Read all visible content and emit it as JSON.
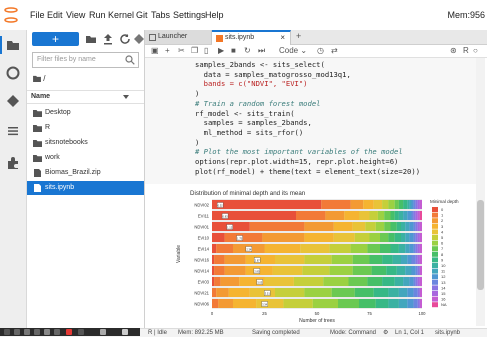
{
  "menu": {
    "items": [
      "File",
      "Edit",
      "View",
      "Run",
      "Kernel",
      "Git",
      "Tabs",
      "Settings",
      "Help"
    ],
    "memory": "Mem:956"
  },
  "filebrowser": {
    "new_label": "+",
    "filter_placeholder": "Filter files by name",
    "breadcrumb": "/",
    "column_name": "Name",
    "files": [
      {
        "name": "Desktop",
        "type": "folder",
        "selected": false
      },
      {
        "name": "R",
        "type": "folder",
        "selected": false
      },
      {
        "name": "sitsnotebooks",
        "type": "folder",
        "selected": false
      },
      {
        "name": "work",
        "type": "folder",
        "selected": false
      },
      {
        "name": "Biomas_Brazil.zip",
        "type": "file",
        "selected": false
      },
      {
        "name": "sits.ipynb",
        "type": "notebook",
        "selected": true
      }
    ]
  },
  "tabs": [
    {
      "label": "Launcher",
      "active": false
    },
    {
      "label": "sits.ipynb",
      "active": true
    }
  ],
  "notebook_toolbar": {
    "cell_type": "Code",
    "kernel_indicator": "R"
  },
  "code_lines": [
    {
      "t": "samples_2bands <- sits_select(",
      "c": ""
    },
    {
      "t": "  data = samples_matogrosso_mod13q1,",
      "c": ""
    },
    {
      "t": "  bands = c(\"NDVI\", \"EVI\")",
      "c": "str"
    },
    {
      "t": ")",
      "c": ""
    },
    {
      "t": "# Train a random forest model",
      "c": "cmt"
    },
    {
      "t": "rf_model <- sits_train(",
      "c": ""
    },
    {
      "t": "  samples = samples_2bands,",
      "c": ""
    },
    {
      "t": "  ml_method = sits_rfor()",
      "c": ""
    },
    {
      "t": ")",
      "c": ""
    },
    {
      "t": "# Plot the most important variables of the model",
      "c": "cmt"
    },
    {
      "t": "options(repr.plot.width=15, repr.plot.height=6)",
      "c": ""
    },
    {
      "t": "plot(rf_model) + theme(text = element_text(size=20))",
      "c": ""
    }
  ],
  "chart_data": {
    "type": "bar",
    "title": "Distribution of minimal depth and its mean",
    "xlabel": "Number of trees",
    "ylabel": "Variable",
    "xlim": [
      0,
      100
    ],
    "xticks": [
      0,
      25,
      50,
      75,
      100
    ],
    "categories": [
      "NDVI02",
      "EVI11",
      "NDVI01",
      "EVI10",
      "EVI14",
      "NDVI16",
      "NDVI14",
      "EVI03",
      "NDVI21",
      "NDVI06"
    ],
    "mean_min_depth": [
      0.52,
      0.83,
      1.12,
      1.75,
      2.34,
      2.87,
      2.85,
      3.03,
      3.51,
      3.34
    ],
    "depth_levels": [
      "0",
      "1",
      "2",
      "3",
      "4",
      "5",
      "6",
      "7",
      "8",
      "9",
      "10",
      "11",
      "12",
      "13",
      "14",
      "15",
      "16",
      "NA"
    ],
    "depth_colors": [
      "#e8503a",
      "#f27a38",
      "#f39a34",
      "#f5b431",
      "#e9c338",
      "#c5cf3a",
      "#9bd142",
      "#6bc952",
      "#46bf68",
      "#37b886",
      "#3bb1a2",
      "#43a6bd",
      "#4f97d2",
      "#6b86df",
      "#8a74e2",
      "#a866de",
      "#c45dd2",
      "#e84a9a"
    ],
    "legend_title": "Minimal depth",
    "segments": [
      [
        52,
        14,
        6,
        5,
        4,
        3,
        3,
        2,
        2,
        2,
        1,
        1,
        1,
        1,
        1,
        1,
        1,
        0
      ],
      [
        40,
        14,
        9,
        7,
        5,
        4,
        3,
        3,
        2,
        2,
        2,
        2,
        2,
        1,
        1,
        1,
        1,
        1
      ],
      [
        18,
        26,
        14,
        9,
        6,
        5,
        4,
        3,
        3,
        2,
        2,
        2,
        2,
        1,
        1,
        1,
        1,
        0
      ],
      [
        6,
        18,
        20,
        14,
        10,
        7,
        5,
        4,
        3,
        3,
        2,
        2,
        2,
        1,
        1,
        1,
        1,
        0
      ],
      [
        2,
        8,
        15,
        17,
        14,
        10,
        8,
        6,
        5,
        4,
        3,
        2,
        2,
        1,
        1,
        1,
        1,
        0
      ],
      [
        1,
        5,
        10,
        14,
        14,
        13,
        10,
        8,
        6,
        5,
        4,
        3,
        2,
        2,
        1,
        1,
        1,
        0
      ],
      [
        1,
        5,
        10,
        13,
        14,
        13,
        11,
        9,
        7,
        5,
        4,
        3,
        2,
        1,
        1,
        0,
        1,
        0
      ],
      [
        1,
        3,
        9,
        12,
        14,
        14,
        12,
        9,
        7,
        6,
        4,
        3,
        2,
        1,
        1,
        1,
        1,
        0
      ],
      [
        0,
        2,
        6,
        10,
        12,
        14,
        13,
        11,
        9,
        7,
        5,
        4,
        3,
        2,
        1,
        0,
        1,
        0
      ],
      [
        0,
        3,
        7,
        11,
        13,
        14,
        12,
        10,
        8,
        6,
        5,
        4,
        3,
        2,
        1,
        0,
        1,
        0
      ]
    ]
  },
  "status": {
    "mode_text": "R | Idle",
    "mem_text": "Mem: 892.25 MB",
    "save_text": "Saving completed",
    "command_text": "Mode: Command",
    "cursor_text": "Ln 1, Col 1",
    "file_text": "sits.ipynb"
  },
  "colors": {
    "accent": "#1976d2"
  }
}
